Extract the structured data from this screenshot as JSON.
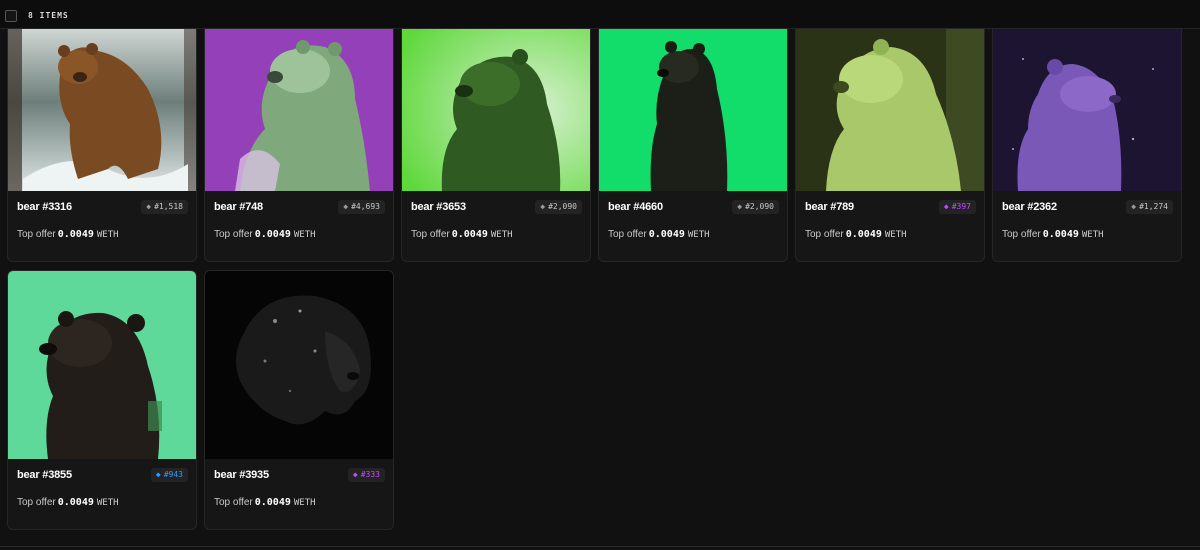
{
  "header": {
    "items_count": "8 ITEMS"
  },
  "cards": [
    {
      "name": "bear #3316",
      "rank": "#1,518",
      "rank_color": "default",
      "offer_label": "Top offer",
      "price": "0.0049",
      "currency": "WETH"
    },
    {
      "name": "bear #748",
      "rank": "#4,693",
      "rank_color": "default",
      "offer_label": "Top offer",
      "price": "0.0049",
      "currency": "WETH"
    },
    {
      "name": "bear #3653",
      "rank": "#2,090",
      "rank_color": "default",
      "offer_label": "Top offer",
      "price": "0.0049",
      "currency": "WETH"
    },
    {
      "name": "bear #4660",
      "rank": "#2,090",
      "rank_color": "default",
      "offer_label": "Top offer",
      "price": "0.0049",
      "currency": "WETH"
    },
    {
      "name": "bear #789",
      "rank": "#397",
      "rank_color": "#c34bff",
      "offer_label": "Top offer",
      "price": "0.0049",
      "currency": "WETH"
    },
    {
      "name": "bear #2362",
      "rank": "#1,274",
      "rank_color": "default",
      "offer_label": "Top offer",
      "price": "0.0049",
      "currency": "WETH"
    },
    {
      "name": "bear #3855",
      "rank": "#943",
      "rank_color": "#2f9bff",
      "offer_label": "Top offer",
      "price": "0.0049",
      "currency": "WETH"
    },
    {
      "name": "bear #3935",
      "rank": "#333",
      "rank_color": "#c34bff",
      "offer_label": "Top offer",
      "price": "0.0049",
      "currency": "WETH"
    }
  ],
  "colors": {
    "background": "#111111",
    "card": "#161616",
    "rare_purple": "#c34bff",
    "rare_blue": "#2f9bff"
  }
}
